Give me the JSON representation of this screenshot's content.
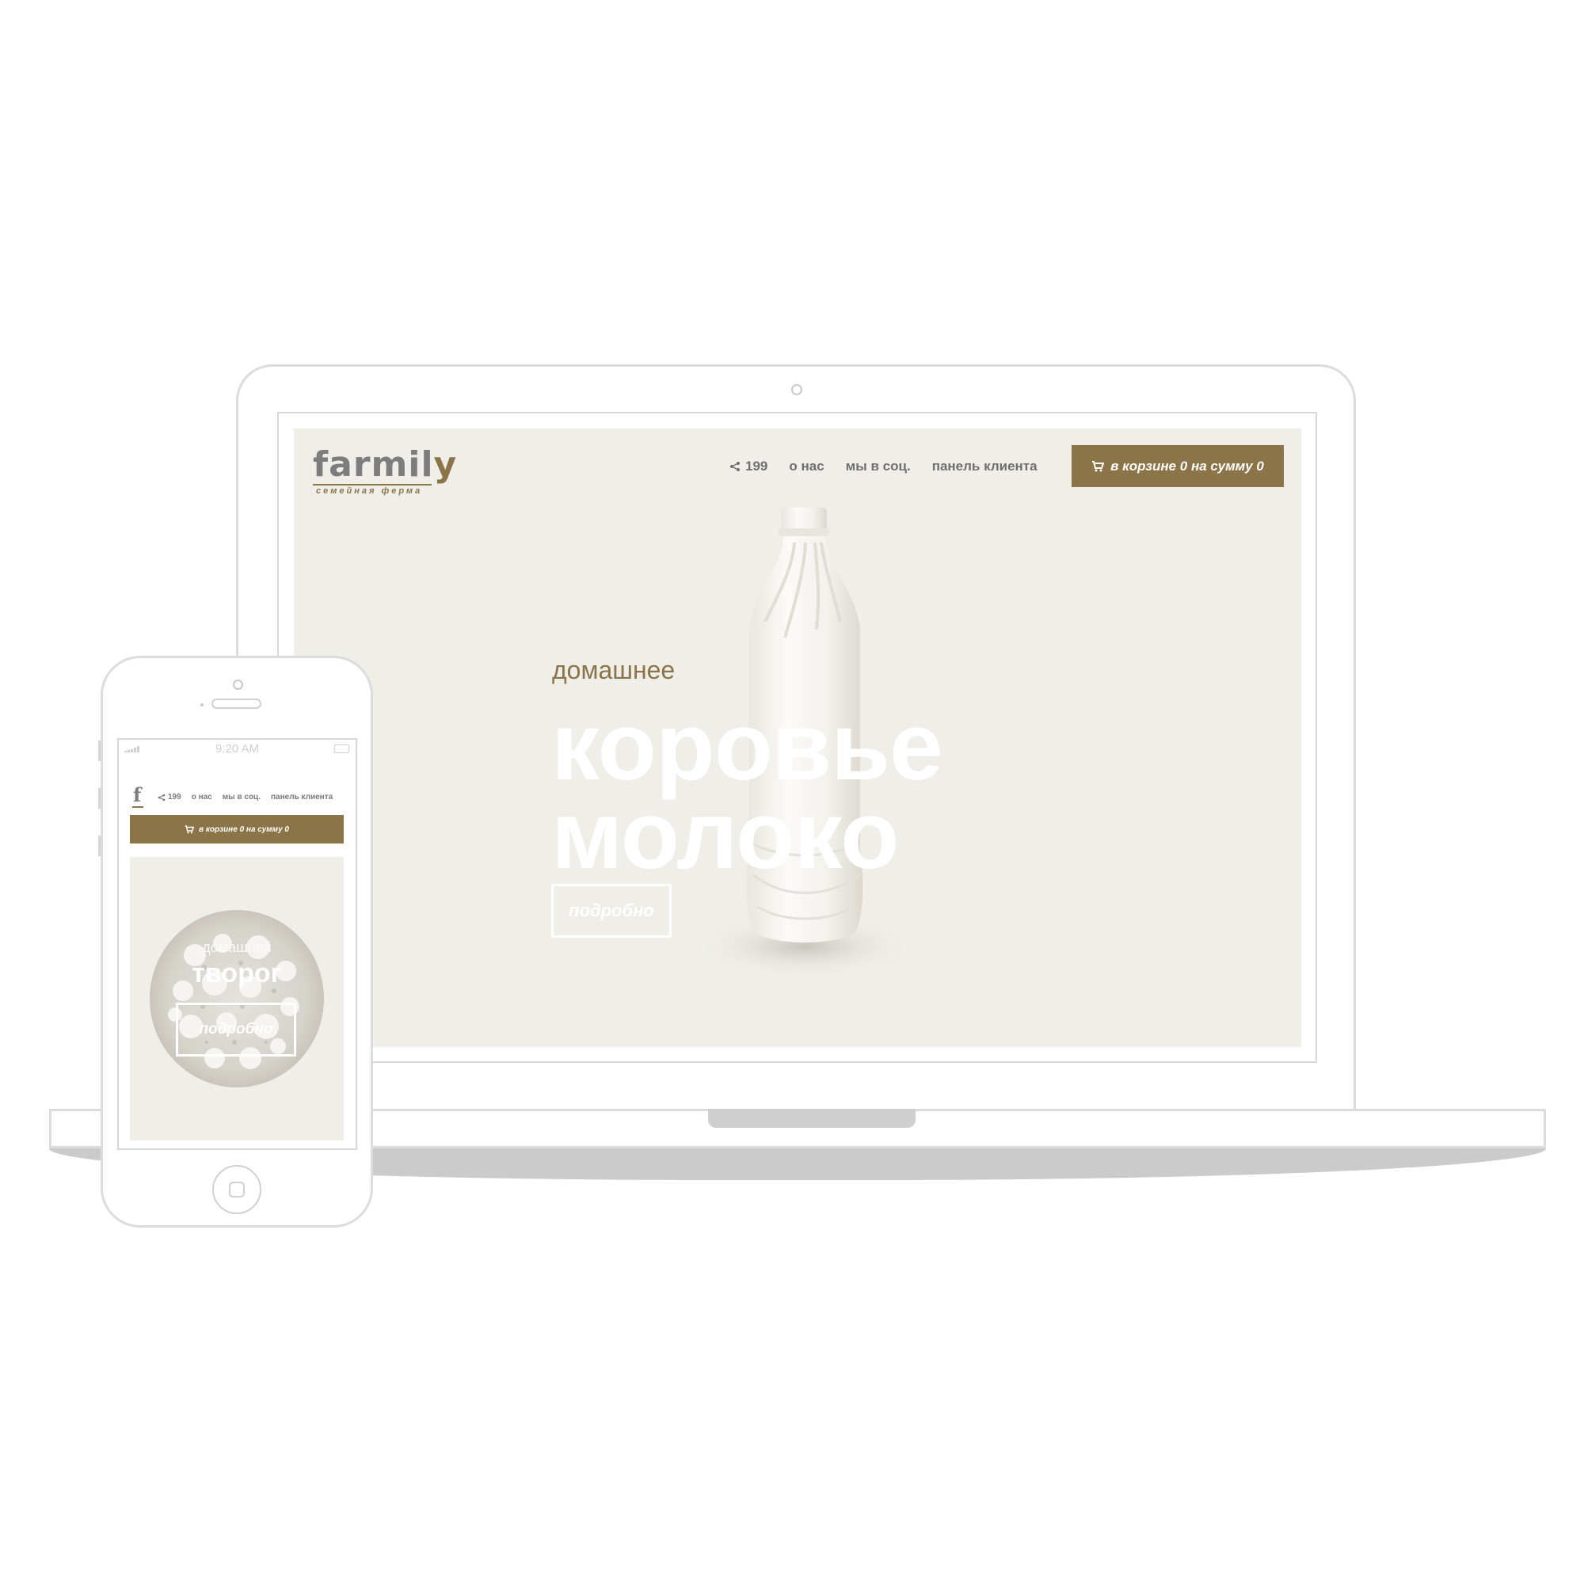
{
  "colors": {
    "accent": "#8b7448",
    "screen_bg": "#efeee9",
    "device_frame": "#dcdcdc"
  },
  "desktop": {
    "logo": {
      "word_main": "farmil",
      "word_end": "y",
      "tagline": "семейная ферма"
    },
    "nav": {
      "share_icon": "share-icon",
      "share_count": "199",
      "about": "о нас",
      "social": "мы в соц.",
      "client_panel": "панель клиента"
    },
    "cart": {
      "icon": "cart-icon",
      "label": "в корзине 0 на сумму 0"
    },
    "hero": {
      "subtitle": "домашнее",
      "title_line1": "коровье",
      "title_line2": "молоко",
      "button": "подробно",
      "image": "milk-bottle"
    }
  },
  "phone": {
    "status": {
      "time": "9:20 AM",
      "signal_icon": "signal-icon",
      "battery_icon": "battery-icon"
    },
    "logo": "f",
    "nav": {
      "share_count": "199",
      "about": "о нас",
      "social": "мы в соц.",
      "client_panel": "панель клиента"
    },
    "cart": {
      "label": "в корзине 0 на сумму 0"
    },
    "hero": {
      "subtitle": "домашний",
      "title": "творог",
      "button": "подробно",
      "image": "cottage-cheese"
    }
  }
}
